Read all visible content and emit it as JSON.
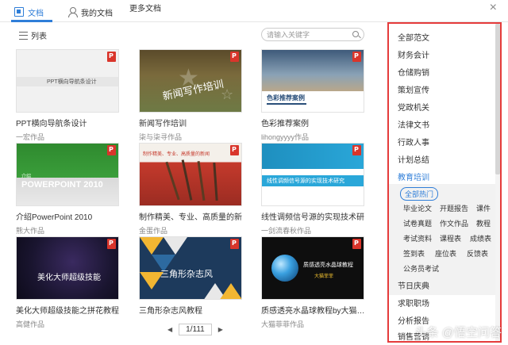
{
  "topbar": {
    "tab_docs": "文档",
    "tab_mine": "我的文档",
    "tab_more": "更多文档",
    "close": "×"
  },
  "toolbar": {
    "list_label": "列表",
    "search_placeholder": "请输入关键字"
  },
  "cards": [
    {
      "title": "PPT横向导航条设计",
      "author": "一宏作品",
      "thumb_text": "PPT横向导航条设计"
    },
    {
      "title": "新闻写作培训",
      "author": "柒与柒寻作品",
      "thumb_text": "新闻写作培训"
    },
    {
      "title": "色彩推荐案例",
      "author": "lihongyyyy作品",
      "thumb_text": "色彩推荐案例"
    },
    {
      "title": "介绍PowerPoint 2010",
      "author": "熊大作品",
      "thumb_text": "POWERPOINT 2010",
      "thumb_text2": "介绍"
    },
    {
      "title": "制作精美、专业、高质量的新…",
      "author": "金蛋作品",
      "thumb_text": "制作精美、专业、高质量的新闻"
    },
    {
      "title": "线性调频信号源的实现技术研究",
      "author": "一剑流春秋作品",
      "thumb_text": "线性调频信号源的实现技术研究"
    },
    {
      "title": "美化大师超级技能之拼花教程",
      "author": "高健作品",
      "thumb_text": "美化大师超级技能"
    },
    {
      "title": "三角形杂志风教程",
      "author": "",
      "thumb_text": "三角形杂志风"
    },
    {
      "title": "质感透亮水晶球教程by大猫…",
      "author": "大猫菲菲作品",
      "thumb_text": "质感透亮水晶球教程",
      "thumb_text2": "大猫菲菲"
    }
  ],
  "pager": {
    "prev": "◀",
    "page": "1/111",
    "next": "▶"
  },
  "sidebar": {
    "items_top": [
      "全部范文",
      "财务会计",
      "仓储购销",
      "策划宣传",
      "党政机关",
      "法律文书",
      "行政人事",
      "计划总结",
      "教育培训"
    ],
    "active_item": "教育培训",
    "sub_pill": "全部热门",
    "sub_items": [
      [
        "毕业论文",
        "开题报告",
        "课件"
      ],
      [
        "试卷真题",
        "作文作品",
        "教程"
      ],
      [
        "考试资料",
        "课程表",
        "成绩表"
      ],
      [
        "签到表",
        "座位表",
        "反馈表"
      ],
      [
        "公务员考试"
      ]
    ],
    "items_bottom": [
      "节日庆典",
      "求职职场",
      "分析报告",
      "销售营销"
    ]
  },
  "watermark": "头条 @悟空问答",
  "colors": {
    "accent": "#2f7ed8",
    "highlight_border": "#e53b3b",
    "badge": "#d9352b"
  }
}
